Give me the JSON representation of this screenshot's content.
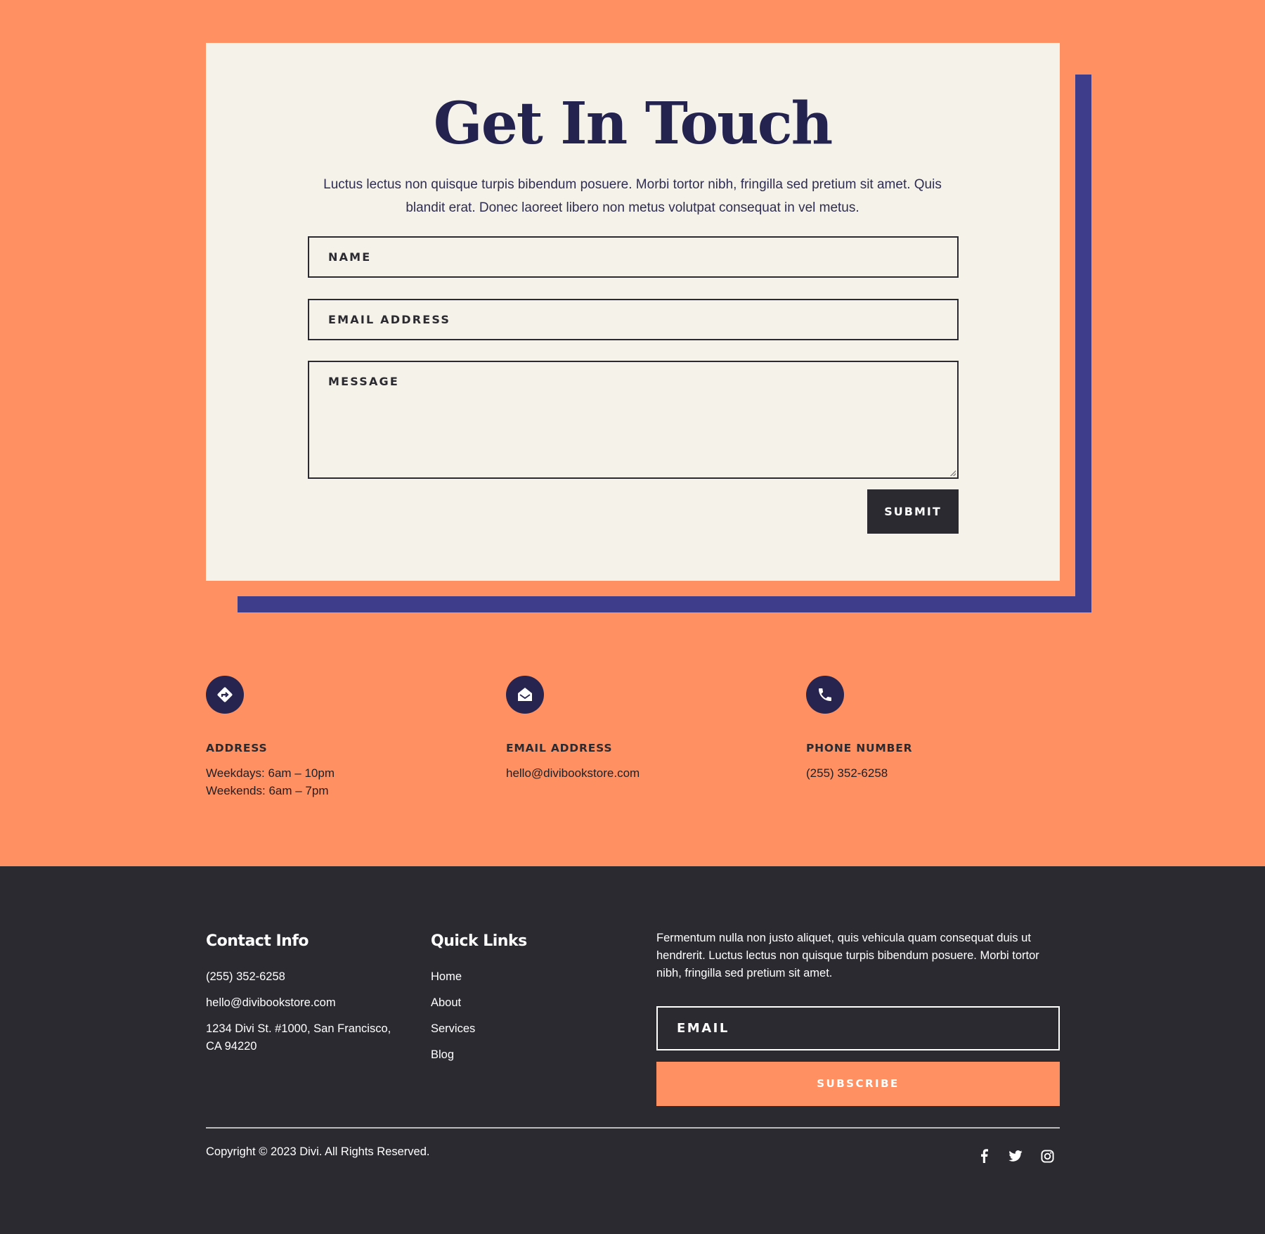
{
  "contact_form": {
    "title": "Get In Touch",
    "intro": "Luctus lectus non quisque turpis bibendum posuere. Morbi tortor nibh, fringilla sed pretium sit amet. Quis blandit erat. Donec laoreet libero non metus volutpat consequat in vel metus.",
    "name_placeholder": "NAME",
    "email_placeholder": "EMAIL ADDRESS",
    "message_placeholder": "MESSAGE",
    "submit_label": "SUBMIT"
  },
  "info_blocks": [
    {
      "icon": "directions-icon",
      "label": "ADDRESS",
      "lines": [
        "Weekdays: 6am – 10pm",
        "Weekends: 6am – 7pm"
      ]
    },
    {
      "icon": "envelope-open-icon",
      "label": "EMAIL ADDRESS",
      "lines": [
        "hello@divibookstore.com"
      ]
    },
    {
      "icon": "phone-icon",
      "label": "PHONE NUMBER",
      "lines": [
        "(255) 352-6258"
      ]
    }
  ],
  "footer": {
    "contact_heading": "Contact Info",
    "contact_lines": [
      "(255) 352-6258",
      "hello@divibookstore.com",
      "1234 Divi St. #1000, San Francisco, CA 94220"
    ],
    "links_heading": "Quick Links",
    "links": [
      "Home",
      "About",
      "Services",
      "Blog"
    ],
    "blurb": "Fermentum nulla non justo aliquet, quis vehicula quam consequat duis ut hendrerit. Luctus lectus non quisque turpis bibendum posuere. Morbi tortor nibh, fringilla sed pretium sit amet.",
    "email_placeholder": "EMAIL",
    "subscribe_label": "SUBSCRIBE",
    "copyright": "Copyright © 2023 Divi. All Rights Reserved.",
    "social": [
      "facebook-icon",
      "twitter-icon",
      "instagram-icon"
    ]
  },
  "colors": {
    "background": "#ff9061",
    "card": "#f5f2e9",
    "accent_shadow": "#3d3d8c",
    "heading": "#24224f",
    "dark": "#2b2a30"
  }
}
